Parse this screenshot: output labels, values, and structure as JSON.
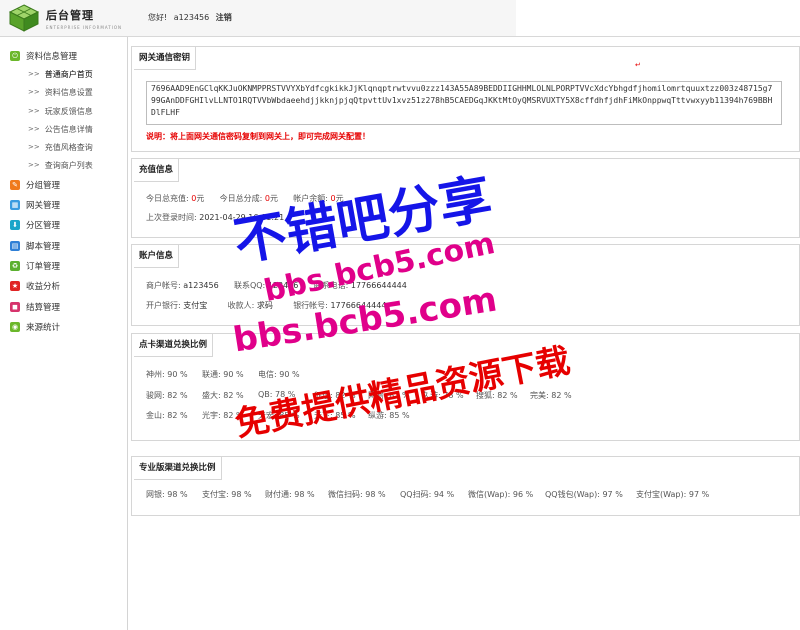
{
  "header": {
    "brand_title": "后台管理",
    "brand_sub": "ENTERPRISE INFORMATION",
    "greeting": "您好!",
    "username": "a123456",
    "logout": "注销"
  },
  "sidebar": {
    "items": [
      {
        "label": "资料信息管理",
        "icon": "power-icon",
        "color": "#6bb72b"
      },
      {
        "label": "分组管理",
        "icon": "pencil-icon",
        "color": "#f07a1c"
      },
      {
        "label": "网关管理",
        "icon": "gateway-icon",
        "color": "#3a9be0"
      },
      {
        "label": "分区管理",
        "icon": "download-icon",
        "color": "#1aa5c9"
      },
      {
        "label": "脚本管理",
        "icon": "script-icon",
        "color": "#2f7fd6"
      },
      {
        "label": "订单管理",
        "icon": "recycle-icon",
        "color": "#5bb030"
      },
      {
        "label": "收益分析",
        "icon": "star-icon",
        "color": "#e02424"
      },
      {
        "label": "结算管理",
        "icon": "settle-icon",
        "color": "#d6336c"
      },
      {
        "label": "来源统计",
        "icon": "source-icon",
        "color": "#6bb72b"
      }
    ],
    "sub_items": [
      {
        "label": "普通商户首页"
      },
      {
        "label": "资料信息设置"
      },
      {
        "label": "玩家反馈信息"
      },
      {
        "label": "公告信息详情"
      },
      {
        "label": "充值风格查询"
      },
      {
        "label": "查询商户列表"
      }
    ],
    "arrow": ">>"
  },
  "gateway": {
    "title": "网关通信密钥",
    "key": "7696AAD9EnGClqKKJuOKNMPPRSTVVYXbYdfcgkikkJjKlqnqptrwtvvu0zzz143A55A89BEDDIIGHHMLOLNLPORPTVVcXdcYbhgdfjhomilomrtquuxtzz003z48715g799GAnDDFGHIlvLLNTO1RQTVVbWbdaeehdjjkknjpjqQtpvttUv1xvz51z278hB5CAEDGqJKKtMtOyQMSRVUXTY5X8cffdhfjdhFiMkOnppwqTttvwxyyb11394h769BBHDlFLHF",
    "note": "说明：将上面网关通信密码复制到网关上，即可完成网关配置！"
  },
  "recharge": {
    "title": "充值信息",
    "today_recharge_label": "今日总充值:",
    "today_recharge_value": "0",
    "today_share_label": "今日总分成:",
    "today_share_value": "0",
    "balance_label": "帐户余额:",
    "balance_value": "0",
    "unit": "元",
    "last_login_label": "上次登录时间:",
    "last_login_value": "2021-04-29 16:01:21"
  },
  "account": {
    "title": "账户信息",
    "merchant_label": "商户帐号:",
    "merchant_value": "a123456",
    "qq_label": "联系QQ:",
    "qq_value": "123456",
    "phone_label": "联系电话:",
    "phone_value": "17766644444",
    "bank_label": "开户银行:",
    "bank_value": "支付宝",
    "payee_label": "收款人:",
    "payee_value": "求码",
    "bank_account_label": "银行帐号:",
    "bank_account_value": "17766644444"
  },
  "card_rates": {
    "title": "点卡渠道兑换比例",
    "rows": [
      [
        {
          "name": "神州:",
          "rate": "90 %"
        },
        {
          "name": "联通:",
          "rate": "90 %"
        },
        {
          "name": "电信:",
          "rate": "90 %"
        }
      ],
      [
        {
          "name": "骏网:",
          "rate": "82 %"
        },
        {
          "name": "盛大:",
          "rate": "82 %"
        },
        {
          "name": "QB:",
          "rate": "78 %"
        },
        {
          "name": "征途:",
          "rate": "82 %"
        },
        {
          "name": "网易:",
          "rate": "82 %"
        },
        {
          "name": "久游:",
          "rate": "78 %"
        },
        {
          "name": "搜狐:",
          "rate": "82 %"
        },
        {
          "name": "完美:",
          "rate": "82 %"
        }
      ],
      [
        {
          "name": "金山:",
          "rate": "82 %"
        },
        {
          "name": "光宇:",
          "rate": "82 %"
        },
        {
          "name": "天宏:",
          "rate": "85 %"
        },
        {
          "name": "天下:",
          "rate": "85 %"
        },
        {
          "name": "纵游:",
          "rate": "85 %"
        }
      ]
    ]
  },
  "bank_rates": {
    "title": "专业版渠道兑换比例",
    "items": [
      {
        "name": "网银:",
        "rate": "98 %"
      },
      {
        "name": "支付宝:",
        "rate": "98 %"
      },
      {
        "name": "财付通:",
        "rate": "98 %"
      },
      {
        "name": "微信扫码:",
        "rate": "98 %"
      },
      {
        "name": "QQ扫码:",
        "rate": "94 %"
      },
      {
        "name": "微信(Wap):",
        "rate": "96 %"
      },
      {
        "name": "QQ钱包(Wap):",
        "rate": "97 %"
      },
      {
        "name": "支付宝(Wap):",
        "rate": "97 %"
      }
    ]
  },
  "watermark": {
    "line1": "不错吧分享",
    "line2": "bbs.bcb5.com",
    "line3": "bbs.bcb5.com",
    "line4": "免费提供精品资源下载"
  }
}
